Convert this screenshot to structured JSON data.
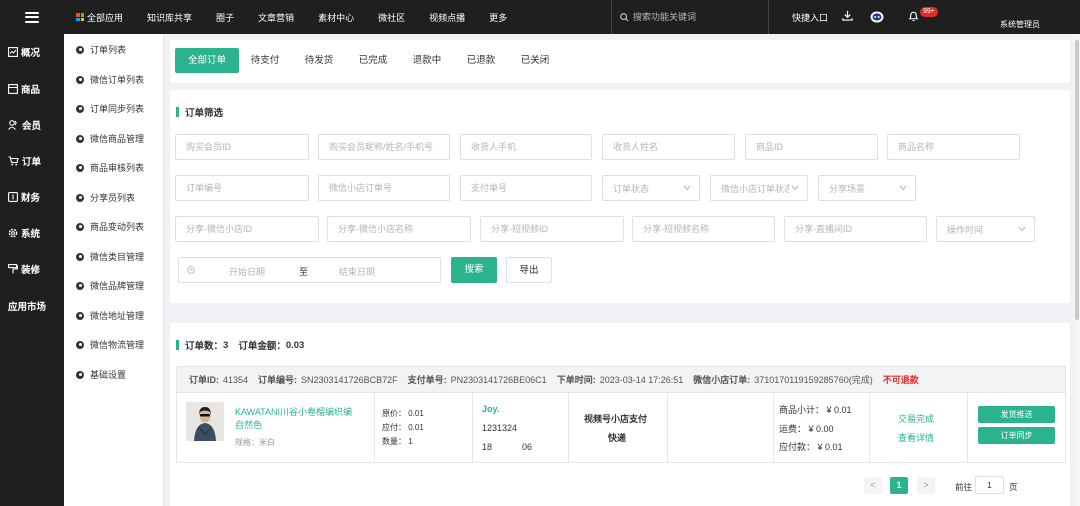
{
  "topbar": {
    "nav": [
      "全部应用",
      "知识库共享",
      "圈子",
      "文章营销",
      "素材中心",
      "微社区",
      "视频点播",
      "更多"
    ],
    "search_placeholder": "搜索功能关键词",
    "quick_entry": "快捷入口",
    "badge": "99+",
    "admin": "系统管理员"
  },
  "sidebar": {
    "items": [
      "概况",
      "商品",
      "会员",
      "订单",
      "财务",
      "系统",
      "装修",
      "应用市场"
    ]
  },
  "subnav": {
    "items": [
      "订单列表",
      "微信订单列表",
      "订单同步列表",
      "微信商品管理",
      "商品审核列表",
      "分享员列表",
      "商品变动列表",
      "微信类目管理",
      "微信品牌管理",
      "微信地址管理",
      "微信物流管理",
      "基础设置"
    ]
  },
  "tabs": [
    "全部订单",
    "待支付",
    "待发货",
    "已完成",
    "退款中",
    "已退款",
    "已关闭"
  ],
  "filter": {
    "title": "订单筛选",
    "row1": [
      "购买会员ID",
      "购买会员昵称/姓名/手机号",
      "收货人手机",
      "收货人姓名",
      "商品ID",
      "商品名称"
    ],
    "row2": [
      "订单编号",
      "微信小店订单号",
      "支付单号",
      "订单状态",
      "微信小店订单状态",
      "分享场景"
    ],
    "row3": [
      "分享-微信小店ID",
      "分享-微信小店名称",
      "分享-短视频ID",
      "分享-短视频名称",
      "分享-直播间ID",
      "操作时间"
    ],
    "date_start": "开始日期",
    "date_sep": "至",
    "date_end": "结束日期",
    "search_btn": "搜索",
    "export_btn": "导出"
  },
  "summary": {
    "count_label": "订单数：",
    "count": "3",
    "amount_label": "订单金额：",
    "amount": "0.03"
  },
  "order": {
    "id_label": "订单ID:",
    "id": "41354",
    "no_label": "订单编号:",
    "no": "SN2303141726BCB72F",
    "pay_label": "支付单号:",
    "pay": "PN2303141726BE06C1",
    "time_label": "下单时间:",
    "time": "2023-03-14 17:26:51",
    "wx_label": "微信小店订单:",
    "wx": "3710170119159285760(完成)",
    "refund_status": "不可退款",
    "product_name_1": "KAWATANI川谷小卷榴编织编",
    "product_name_2": "自然色",
    "spec": "规格：米白",
    "orig_price": "原价： 0.01",
    "due_price": "应付： 0.01",
    "qty": "数量： 1",
    "buyer": "Joy.",
    "phone1": "1231324",
    "phone2": "18            06",
    "pay_method": "视频号小店支付",
    "delivery": "快递",
    "subtotal": "商品小计：  ¥ 0.01",
    "shipping": "运费：  ¥ 0.00",
    "payable": "应付款：  ¥ 0.01",
    "status": "交易完成",
    "detail": "查看详情",
    "ship_btn": "发货推送",
    "sync_btn": "订单同步"
  },
  "pager": {
    "prev": "<",
    "current": "1",
    "next": ">",
    "goto_label": "前往",
    "goto_value": "1",
    "page_label": "页"
  }
}
